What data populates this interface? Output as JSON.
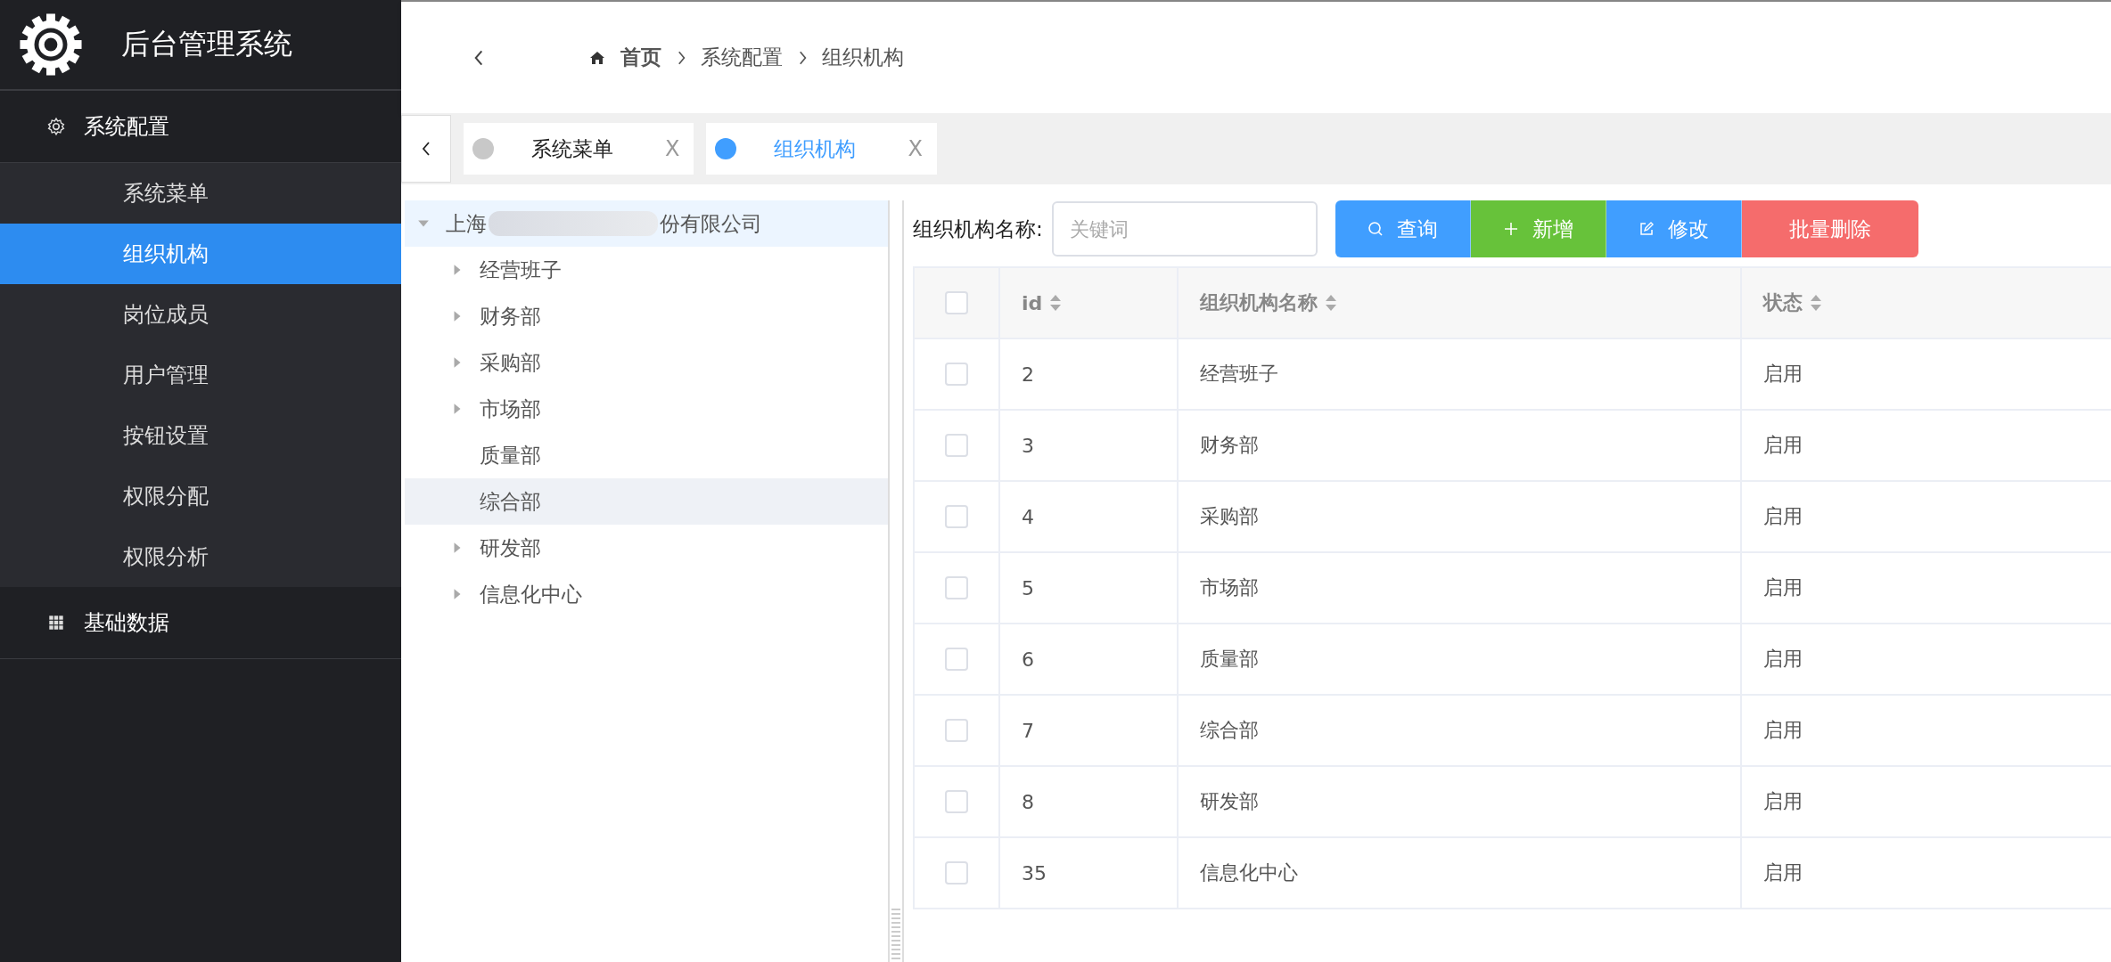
{
  "sidebar": {
    "title": "后台管理系统",
    "groups": [
      {
        "label": "系统配置",
        "kind": "gear",
        "expanded": true,
        "items": [
          {
            "label": "系统菜单",
            "selected": false
          },
          {
            "label": "组织机构",
            "selected": true
          },
          {
            "label": "岗位成员",
            "selected": false
          },
          {
            "label": "用户管理",
            "selected": false
          },
          {
            "label": "按钮设置",
            "selected": false
          },
          {
            "label": "权限分配",
            "selected": false
          },
          {
            "label": "权限分析",
            "selected": false
          }
        ]
      },
      {
        "label": "基础数据",
        "kind": "grid",
        "expanded": false
      }
    ]
  },
  "breadcrumb": [
    "首页",
    "系统配置",
    "组织机构"
  ],
  "tabs": [
    {
      "label": "系统菜单",
      "selected": false,
      "close": "X"
    },
    {
      "label": "组织机构",
      "selected": true,
      "close": "X"
    }
  ],
  "tree": {
    "prefix": "上海",
    "suffix": "份有限公司",
    "expanded": true,
    "selected": true,
    "children": [
      {
        "label": "经营班子",
        "expandable": true,
        "hovered": false
      },
      {
        "label": "财务部",
        "expandable": true,
        "hovered": false
      },
      {
        "label": "采购部",
        "expandable": true,
        "hovered": false
      },
      {
        "label": "市场部",
        "expandable": true,
        "hovered": false
      },
      {
        "label": "质量部",
        "expandable": false,
        "hovered": false
      },
      {
        "label": "综合部",
        "expandable": false,
        "hovered": true
      },
      {
        "label": "研发部",
        "expandable": true,
        "hovered": false
      },
      {
        "label": "信息化中心",
        "expandable": true,
        "hovered": false
      }
    ]
  },
  "filter": {
    "label": "组织机构名称:",
    "placeholder": "关键词"
  },
  "buttons": [
    {
      "kind": "search",
      "label": "查询"
    },
    {
      "kind": "add",
      "label": "新增"
    },
    {
      "kind": "edit",
      "label": "修改"
    },
    {
      "kind": "delete",
      "label": "批量删除"
    }
  ],
  "table": {
    "all_checked": false,
    "columns": [
      {
        "label": "id",
        "sortable": true
      },
      {
        "label": "组织机构名称",
        "sortable": true
      },
      {
        "label": "状态",
        "sortable": true
      }
    ],
    "rows": [
      {
        "checked": false,
        "id": "2",
        "name": "经营班子",
        "status": "启用"
      },
      {
        "checked": false,
        "id": "3",
        "name": "财务部",
        "status": "启用"
      },
      {
        "checked": false,
        "id": "4",
        "name": "采购部",
        "status": "启用"
      },
      {
        "checked": false,
        "id": "5",
        "name": "市场部",
        "status": "启用"
      },
      {
        "checked": false,
        "id": "6",
        "name": "质量部",
        "status": "启用"
      },
      {
        "checked": false,
        "id": "7",
        "name": "综合部",
        "status": "启用"
      },
      {
        "checked": false,
        "id": "8",
        "name": "研发部",
        "status": "启用"
      },
      {
        "checked": false,
        "id": "35",
        "name": "信息化中心",
        "status": "启用"
      }
    ]
  }
}
